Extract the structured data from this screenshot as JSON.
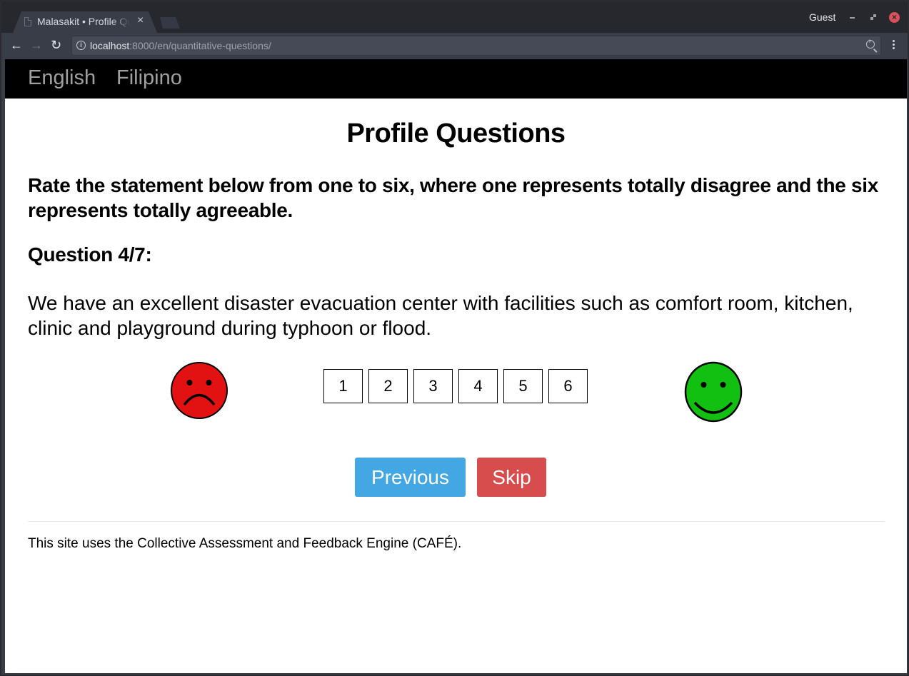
{
  "browser": {
    "tab_title": "Malasakit • Profile Questions",
    "tab_close_glyph": "×",
    "profile_label": "Guest",
    "url_host": "localhost",
    "url_rest": ":8000/en/quantitative-questions/",
    "nav": {
      "back_glyph": "←",
      "forward_glyph": "→",
      "reload_glyph": "↻"
    },
    "window_close_glyph": "×"
  },
  "langbar": {
    "items": [
      {
        "label": "English"
      },
      {
        "label": "Filipino"
      }
    ]
  },
  "page": {
    "title": "Profile Questions",
    "instructions": "Rate the statement below from one to six, where one represents totally disagree and the six represents totally agreeable.",
    "question_counter": "Question 4/7:",
    "question_text": "We have an excellent disaster evacuation center with facilities such as comfort room, kitchen, clinic and playground during typhoon or flood.",
    "scale": {
      "min_icon": "sad-face-icon",
      "max_icon": "happy-face-icon",
      "options": [
        "1",
        "2",
        "3",
        "4",
        "5",
        "6"
      ]
    },
    "actions": {
      "previous_label": "Previous",
      "skip_label": "Skip"
    },
    "footer": "This site uses the Collective Assessment and Feedback Engine (CAFÉ)."
  },
  "colors": {
    "langbar_bg": "#000000",
    "previous_button": "#42a7e3",
    "skip_button": "#d74d4d",
    "sad_face": "#e31212",
    "happy_face": "#12c012"
  }
}
